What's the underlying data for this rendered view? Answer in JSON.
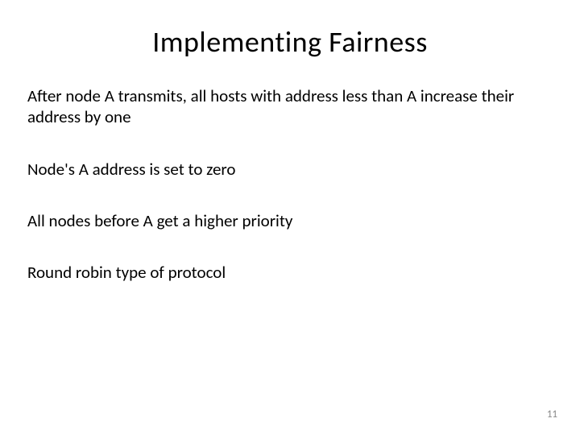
{
  "slide": {
    "title": "Implementing Fairness",
    "bullets": [
      "After node A transmits, all hosts with address less than A increase their address by one",
      "Node's A address is set to zero",
      "All nodes before A get a higher priority",
      "Round robin type of protocol"
    ],
    "page_number": "11"
  }
}
